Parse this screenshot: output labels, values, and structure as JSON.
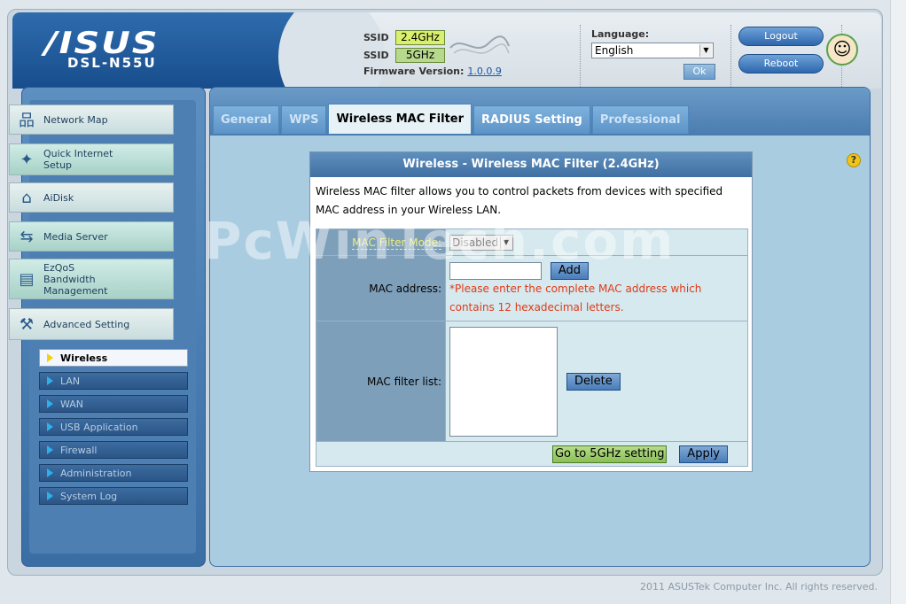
{
  "header": {
    "brand": "/ISUS",
    "model": "DSL-N55U",
    "ssid_label": "SSID",
    "ssid_24": "2.4GHz",
    "ssid_5": "5GHz",
    "firmware_label": "Firmware Version:",
    "firmware_value": "1.0.0.9",
    "language_label": "Language:",
    "language_value": "English",
    "ok_label": "Ok",
    "logout_label": "Logout",
    "reboot_label": "Reboot"
  },
  "sidebar": {
    "items": [
      {
        "label": "Network Map",
        "icon": "network-map-icon"
      },
      {
        "label": "Quick Internet Setup",
        "icon": "wand-icon"
      },
      {
        "label": "AiDisk",
        "icon": "disk-icon"
      },
      {
        "label": "Media Server",
        "icon": "media-server-icon"
      },
      {
        "label": "EzQoS Bandwidth Management",
        "icon": "qos-icon"
      },
      {
        "label": "Advanced Setting",
        "icon": "tools-icon"
      }
    ],
    "sub_items": [
      "Wireless",
      "LAN",
      "WAN",
      "USB Application",
      "Firewall",
      "Administration",
      "System Log"
    ]
  },
  "tabs": [
    "General",
    "WPS",
    "Wireless MAC Filter",
    "RADIUS Setting",
    "Professional"
  ],
  "panel": {
    "title": "Wireless - Wireless MAC Filter (2.4GHz)",
    "description": "Wireless MAC filter allows you to control packets from devices with specified MAC address in your Wireless LAN.",
    "mode_label": "MAC Filter Mode:",
    "mode_value": "Disabled",
    "mac_label": "MAC address:",
    "add_label": "Add",
    "mac_warning": "*Please enter the complete MAC address which contains 12 hexadecimal letters.",
    "list_label": "MAC filter list:",
    "delete_label": "Delete",
    "goto5_label": "Go to 5GHz setting",
    "apply_label": "Apply"
  },
  "watermark": "PcWinTech.com",
  "footer": "2011 ASUSTek Computer Inc. All rights reserved."
}
